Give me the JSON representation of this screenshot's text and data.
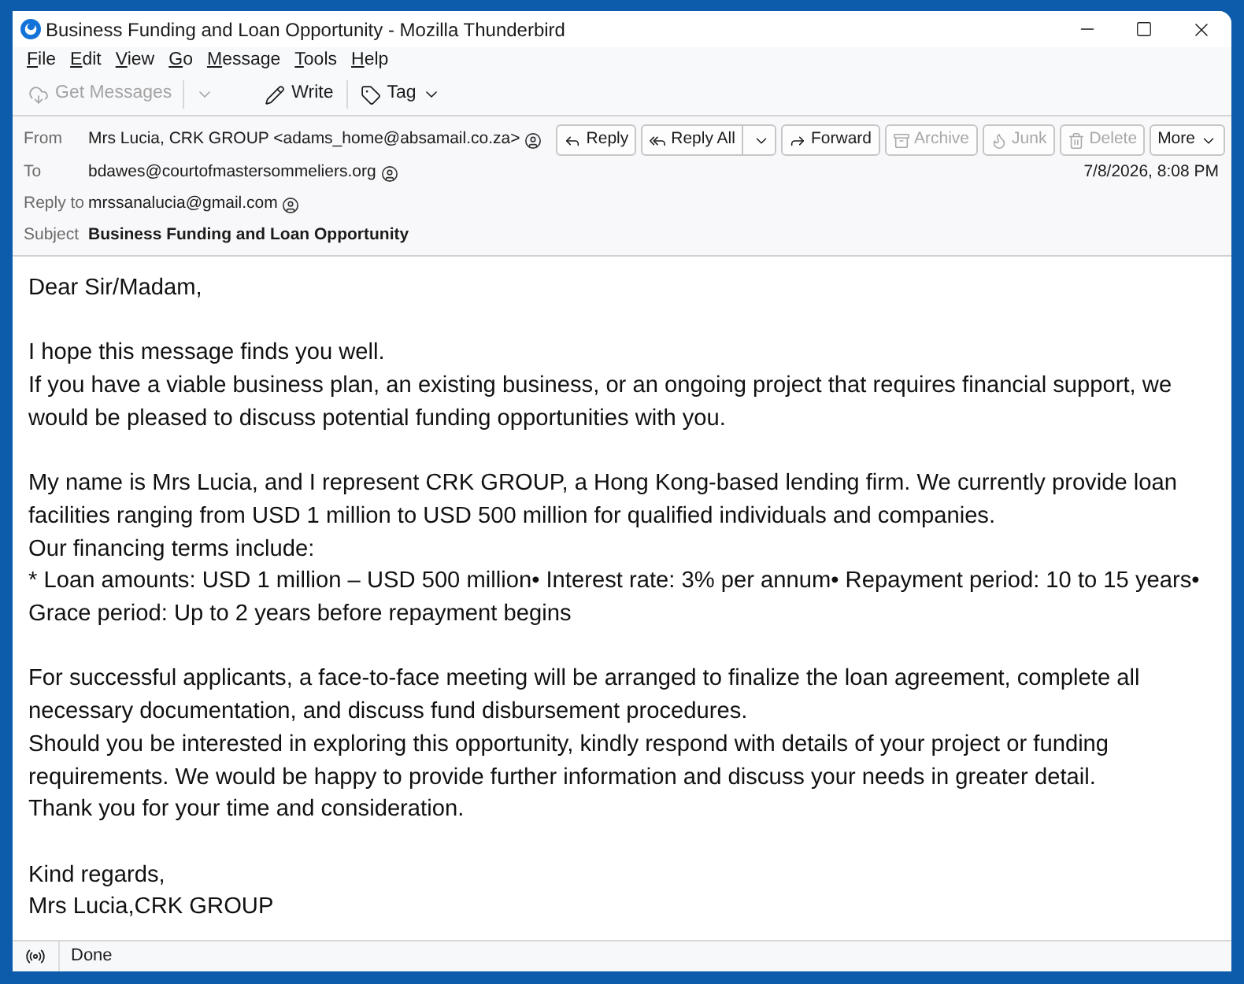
{
  "window": {
    "title": "Business Funding and Loan Opportunity - Mozilla Thunderbird"
  },
  "menu": [
    "File",
    "Edit",
    "View",
    "Go",
    "Message",
    "Tools",
    "Help"
  ],
  "toolbar": [
    {
      "kind": "split",
      "label": "Get Messages",
      "disabled": true
    },
    {
      "kind": "button",
      "label": "Write",
      "disabled": false
    },
    {
      "kind": "menu",
      "label": "Tag",
      "disabled": false
    }
  ],
  "header": {
    "fields": [
      {
        "kind": "address",
        "label": "From",
        "value": "Mrs Lucia, CRK GROUP <adams_home@absamail.co.za>"
      },
      {
        "kind": "address",
        "label": "To",
        "value": "bdawes@courtofmastersommeliers.org"
      },
      {
        "kind": "address",
        "label": "Reply to",
        "value": "mrssanalucia@gmail.com"
      },
      {
        "kind": "subject",
        "label": "Subject",
        "value": "Business Funding and Loan Opportunity"
      }
    ],
    "actions": [
      {
        "kind": "button",
        "label": "Reply",
        "disabled": false
      },
      {
        "kind": "split",
        "label": "Reply All",
        "disabled": false
      },
      {
        "kind": "button",
        "label": "Forward",
        "disabled": false
      },
      {
        "kind": "button",
        "label": "Archive",
        "disabled": true
      },
      {
        "kind": "button",
        "label": "Junk",
        "disabled": true
      },
      {
        "kind": "button",
        "label": "Delete",
        "disabled": true
      },
      {
        "kind": "menu",
        "label": "More",
        "disabled": false
      }
    ],
    "date": "7/8/2026, 8:08 PM"
  },
  "body": {
    "paragraphs": [
      [
        "Dear Sir/Madam,"
      ],
      [
        "I hope this message finds you well.",
        "If you have a viable business plan, an existing business, or an ongoing project that requires financial support, we would be pleased to discuss potential funding opportunities with you."
      ],
      [
        "My name is Mrs Lucia, and I represent CRK GROUP, a Hong Kong-based lending firm. We currently provide loan facilities ranging from USD 1 million to USD 500 million for qualified individuals and companies.",
        "Our financing terms include:",
        "* Loan amounts: USD 1 million – USD 500 million• Interest rate: 3% per annum• Repayment period: 10 to 15 years• Grace period: Up to 2 years before repayment begins"
      ],
      [
        "For successful applicants, a face-to-face meeting will be arranged to finalize the loan agreement, complete all necessary documentation, and discuss fund disbursement procedures.",
        "Should you be interested in exploring this opportunity, kindly respond with details of your project or funding requirements. We would be happy to provide further information and discuss your needs in greater detail.",
        "Thank you for your time and consideration."
      ],
      [
        "Kind regards,",
        "Mrs Lucia,CRK GROUP"
      ]
    ]
  },
  "status_bar": {
    "text": "Done"
  }
}
